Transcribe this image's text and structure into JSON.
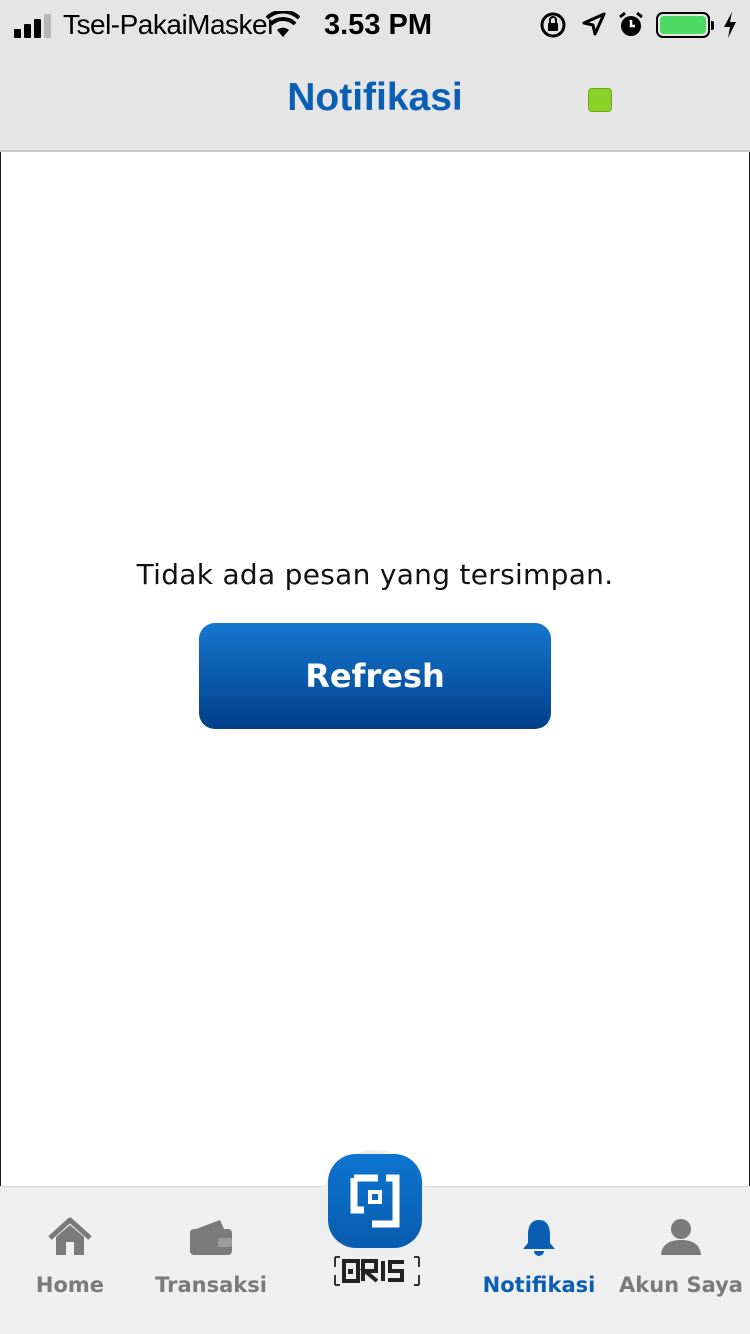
{
  "status_bar": {
    "carrier": "Tsel-PakaiMasker",
    "time": "3.53 PM",
    "battery_color": "#4cd964"
  },
  "header": {
    "title": "Notifikasi",
    "indicator_color": "#8ad22a"
  },
  "main": {
    "empty_message": "Tidak ada pesan yang tersimpan.",
    "refresh_label": "Refresh"
  },
  "tabbar": {
    "items": [
      {
        "label": "Home",
        "icon": "home-icon",
        "active": false
      },
      {
        "label": "Transaksi",
        "icon": "wallet-icon",
        "active": false
      },
      {
        "label": "QRIS",
        "icon": "qris-icon",
        "active": false
      },
      {
        "label": "Notifikasi",
        "icon": "bell-icon",
        "active": true
      },
      {
        "label": "Akun Saya",
        "icon": "user-icon",
        "active": false
      }
    ]
  },
  "colors": {
    "brand": "#0a5eb4",
    "inactive": "#7a7a7a"
  }
}
